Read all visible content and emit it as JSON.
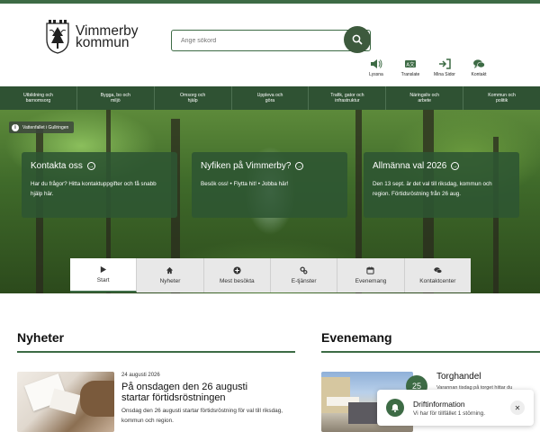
{
  "logo": {
    "line1": "Vimmerby",
    "line2": "kommun"
  },
  "search": {
    "placeholder": "Ange sökord"
  },
  "tools": [
    {
      "icon": "speaker-icon",
      "label": "Lyssna"
    },
    {
      "icon": "translate-icon",
      "label": "Translate"
    },
    {
      "icon": "login-icon",
      "label": "Mina Sidor"
    },
    {
      "icon": "chat-icon",
      "label": "Kontakt"
    }
  ],
  "nav": [
    {
      "line1": "Utbildning och",
      "line2": "barnomsorg"
    },
    {
      "line1": "Bygga, bo och",
      "line2": "miljö"
    },
    {
      "line1": "Omsorg och",
      "line2": "hjälp"
    },
    {
      "line1": "Uppleva och",
      "line2": "göra"
    },
    {
      "line1": "Trafik, gator och",
      "line2": "infrastruktur"
    },
    {
      "line1": "Näringsliv och",
      "line2": "arbete"
    },
    {
      "line1": "Kommun och",
      "line2": "politik"
    }
  ],
  "hero": {
    "badge": "Vattenfallet i Gullringen",
    "cards": [
      {
        "title": "Kontakta oss",
        "text": "Har du frågor? Hitta kontaktuppgifter och få snabb hjälp här."
      },
      {
        "title": "Nyfiken på Vimmerby?",
        "text": "Besök oss! • Flytta hit! • Jobba här!"
      },
      {
        "title": "Allmänna val 2026",
        "text": "Den 13 sept. är det val till riksdag, kommun och region. Förtidsröstning från 26 aug."
      }
    ]
  },
  "tabs": [
    {
      "label": "Start",
      "icon": "play-icon"
    },
    {
      "label": "Nyheter",
      "icon": "home-icon"
    },
    {
      "label": "Mest besökta",
      "icon": "plus-circle-icon"
    },
    {
      "label": "E-tjänster",
      "icon": "gears-icon"
    },
    {
      "label": "Evenemang",
      "icon": "calendar-icon"
    },
    {
      "label": "Kontaktcenter",
      "icon": "chat-icon"
    }
  ],
  "news": {
    "heading": "Nyheter",
    "date": "24 augusti 2026",
    "title": "På onsdagen den 26 augusti startar förtidsröstningen",
    "desc": "Onsdag den 26 augusti startar förtidsröstning för val till riksdag, kommun och region."
  },
  "events": {
    "heading": "Evenemang",
    "day": "25",
    "title": "Torghandel",
    "desc": "Varannan tisdag på torget hittar du"
  },
  "popup": {
    "title": "Driftinformation",
    "text": "Vi har för tillfället 1 störning."
  },
  "colors": {
    "brand": "#3d6b45",
    "nav": "#2f5233"
  }
}
